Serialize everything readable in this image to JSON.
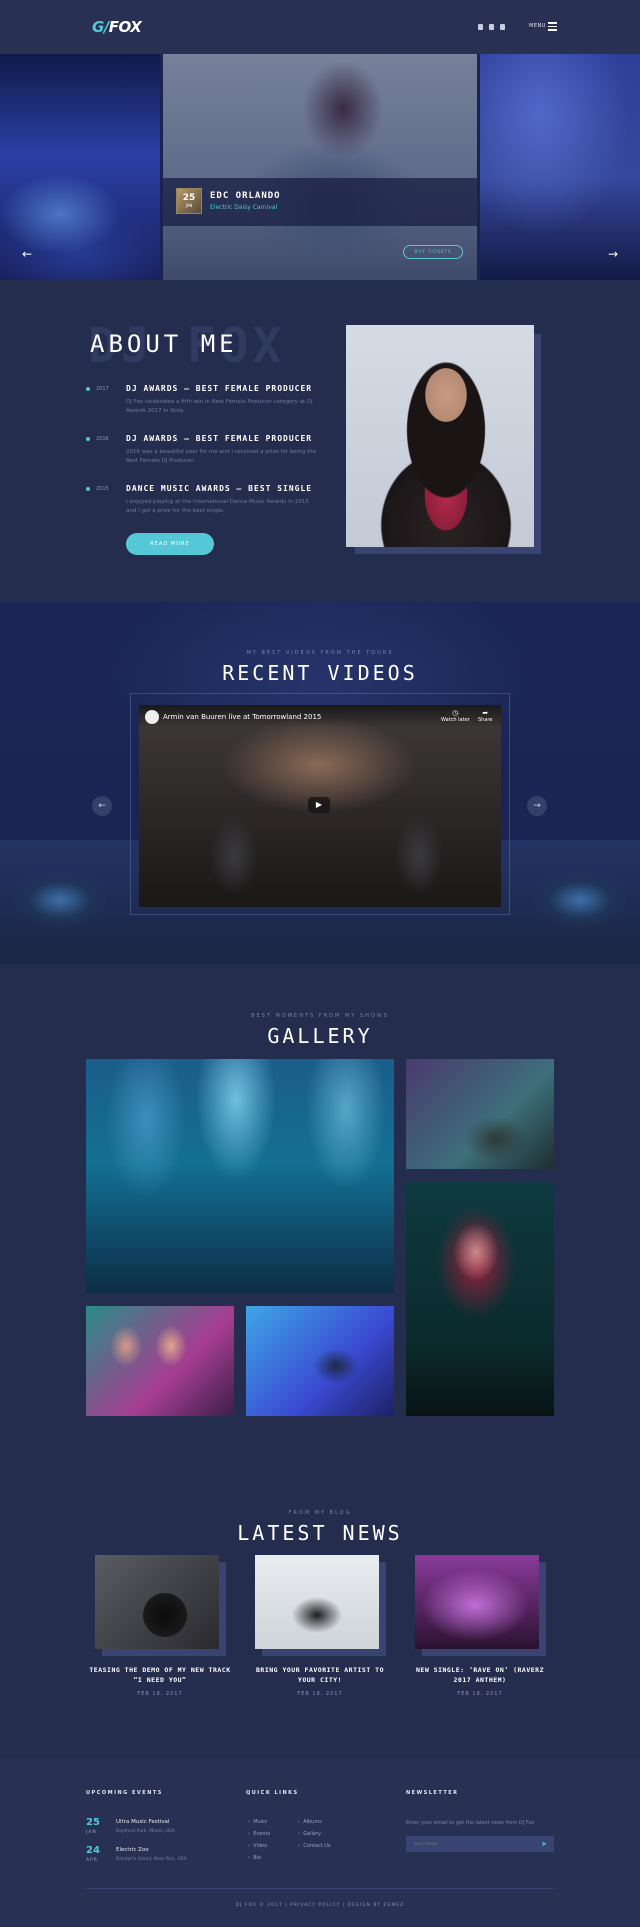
{
  "header": {
    "logo_prefix": "G",
    "logo_suffix": "FOX",
    "menu_label": "MENU"
  },
  "hero": {
    "title": "EDC ORLANDO",
    "subtitle": "Electric Daisy Carnival",
    "date_day": "25",
    "date_month": "JAN",
    "button": "BUY TICKETS"
  },
  "about": {
    "bg_text": "DJ FOX",
    "title": "ABOUT ME",
    "awards": [
      {
        "year": "2017",
        "title": "DJ AWARDS – BEST FEMALE PRODUCER",
        "text": "DJ Fox celebrated a fifth win in Best Female Producer category at Dj Awards 2017 in Ibiza."
      },
      {
        "year": "2016",
        "title": "DJ AWARDS – BEST FEMALE PRODUCER",
        "text": "2016 was a beautiful year for me and I received a prize for being the Best Female DJ Producer."
      },
      {
        "year": "2015",
        "title": "DANCE MUSIC AWARDS – BEST SINGLE",
        "text": "I enjoyed playing at the International Dance Music Awards in 2015 and I got a prize for the best single."
      }
    ],
    "button": "READ MORE"
  },
  "videos": {
    "kicker": "MY BEST VIDEOS FROM THE TOURS",
    "title": "RECENT VIDEOS",
    "video_caption": "Armin van Buuren live at Tomorrowland 2015",
    "watch_later": "Watch later",
    "share": "Share"
  },
  "gallery": {
    "kicker": "BEST MOMENTS FROM MY SHOWS",
    "title": "GALLERY"
  },
  "news": {
    "kicker": "FROM MY BLOG",
    "title": "LATEST NEWS",
    "items": [
      {
        "title": "TEASING THE DEMO OF MY NEW TRACK “I NEED YOU”",
        "date": "FEB 18, 2017"
      },
      {
        "title": "BRING YOUR FAVORITE ARTIST TO YOUR CITY!",
        "date": "FEB 18, 2017"
      },
      {
        "title": "NEW SINGLE: ‘RAVE ON’ (RAVERZ 2017 ANTHEM)",
        "date": "FEB 18, 2017"
      }
    ]
  },
  "footer": {
    "events_heading": "UPCOMING EVENTS",
    "events": [
      {
        "day": "25",
        "month": "JAN",
        "name": "Ultra Music Festival",
        "meta": "Bayfront Park, Miami, USA"
      },
      {
        "day": "24",
        "month": "APR",
        "name": "Electric Zoo",
        "meta": "Randall's Island, New York, USA"
      }
    ],
    "links_heading": "QUICK LINKS",
    "links": [
      "Music",
      "Events",
      "Video",
      "Bio",
      "Albums",
      "Gallery",
      "Contact Us"
    ],
    "newsletter_heading": "NEWSLETTER",
    "newsletter_text": "Enter your email to get the latest news from DJ Fox",
    "newsletter_placeholder": "Your email",
    "copyright": "DJ FOX © 2017 | PRIVACY POLICY | DESIGN BY ZEMEZ"
  },
  "colors": {
    "accent": "#55c8d7",
    "background": "#252d4e",
    "panel": "#283053"
  }
}
